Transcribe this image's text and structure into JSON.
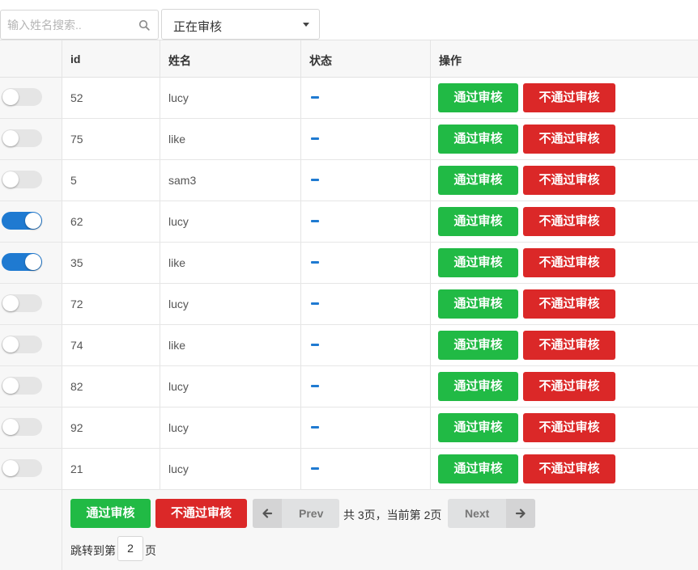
{
  "search": {
    "placeholder": "输入姓名搜索..",
    "value": ""
  },
  "filter": {
    "selected": "正在审核"
  },
  "table": {
    "headers": {
      "id": "id",
      "name": "姓名",
      "status": "状态",
      "action": "操作"
    },
    "rows": [
      {
        "id": "52",
        "name": "lucy",
        "toggle": false
      },
      {
        "id": "75",
        "name": "like",
        "toggle": false
      },
      {
        "id": "5",
        "name": "sam3",
        "toggle": false
      },
      {
        "id": "62",
        "name": "lucy",
        "toggle": true
      },
      {
        "id": "35",
        "name": "like",
        "toggle": true
      },
      {
        "id": "72",
        "name": "lucy",
        "toggle": false
      },
      {
        "id": "74",
        "name": "like",
        "toggle": false
      },
      {
        "id": "82",
        "name": "lucy",
        "toggle": false
      },
      {
        "id": "92",
        "name": "lucy",
        "toggle": false
      },
      {
        "id": "21",
        "name": "lucy",
        "toggle": false
      }
    ],
    "approve_label": "通过审核",
    "reject_label": "不通过审核"
  },
  "footer": {
    "approve_label": "通过审核",
    "reject_label": "不通过审核",
    "prev_label": "Prev",
    "next_label": "Next",
    "page_info": "共 3页，当前第 2页",
    "jump_prefix": "跳转到第",
    "jump_value": "2",
    "jump_suffix": "页"
  },
  "colors": {
    "approve": "#21ba45",
    "reject": "#db2828",
    "accent": "#1f7ad1"
  },
  "icons": {
    "search": "search-icon",
    "prev": "arrow-left-icon",
    "next": "arrow-right-icon",
    "dropdown": "caret-down-icon"
  }
}
